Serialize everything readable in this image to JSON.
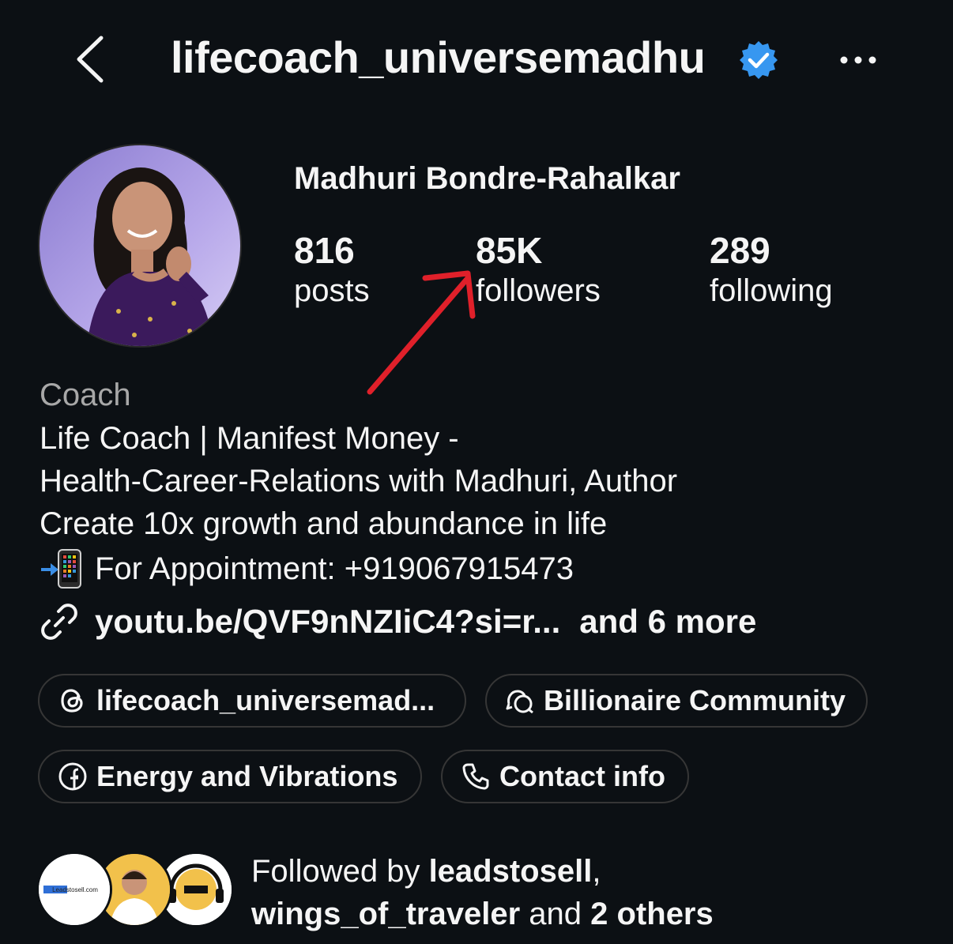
{
  "header": {
    "back_icon": "chevron-left-icon",
    "username": "lifecoach_universemadhu",
    "verified_icon": "verified-badge-icon",
    "verified_color": "#3797f0",
    "more_icon": "more-horizontal-icon"
  },
  "profile": {
    "display_name": "Madhuri Bondre-Rahalkar",
    "stats": [
      {
        "value": "816",
        "label": "posts"
      },
      {
        "value": "85K",
        "label": "followers"
      },
      {
        "value": "289",
        "label": "following"
      }
    ],
    "category": "Coach",
    "bio": [
      "Life Coach | Manifest Money -",
      "Health-Career-Relations with Madhuri, Author",
      "Create 10x growth and abundance in life",
      "For Appointment: +919067915473"
    ],
    "link": {
      "icon": "link-icon",
      "url_text": "youtu.be/QVF9nNZIiC4?si=r...",
      "more_text": "and 6 more"
    }
  },
  "chips": {
    "threads": {
      "icon": "threads-icon",
      "label": "lifecoach_universemad..."
    },
    "community": {
      "icon": "community-chat-icon",
      "label": "Billionaire Community"
    },
    "facebook": {
      "icon": "facebook-icon",
      "label": "Energy and Vibrations"
    },
    "contact": {
      "icon": "phone-icon",
      "label": "Contact info"
    }
  },
  "followed_by": {
    "prefix": "Followed by",
    "user1": "leadstosell",
    "sep": ",",
    "user2": "wings_of_traveler",
    "and": "and",
    "others": "2 others",
    "avatar1_text": "Leadstosell.com"
  },
  "annotation": {
    "arrow_color": "#e0202a"
  }
}
